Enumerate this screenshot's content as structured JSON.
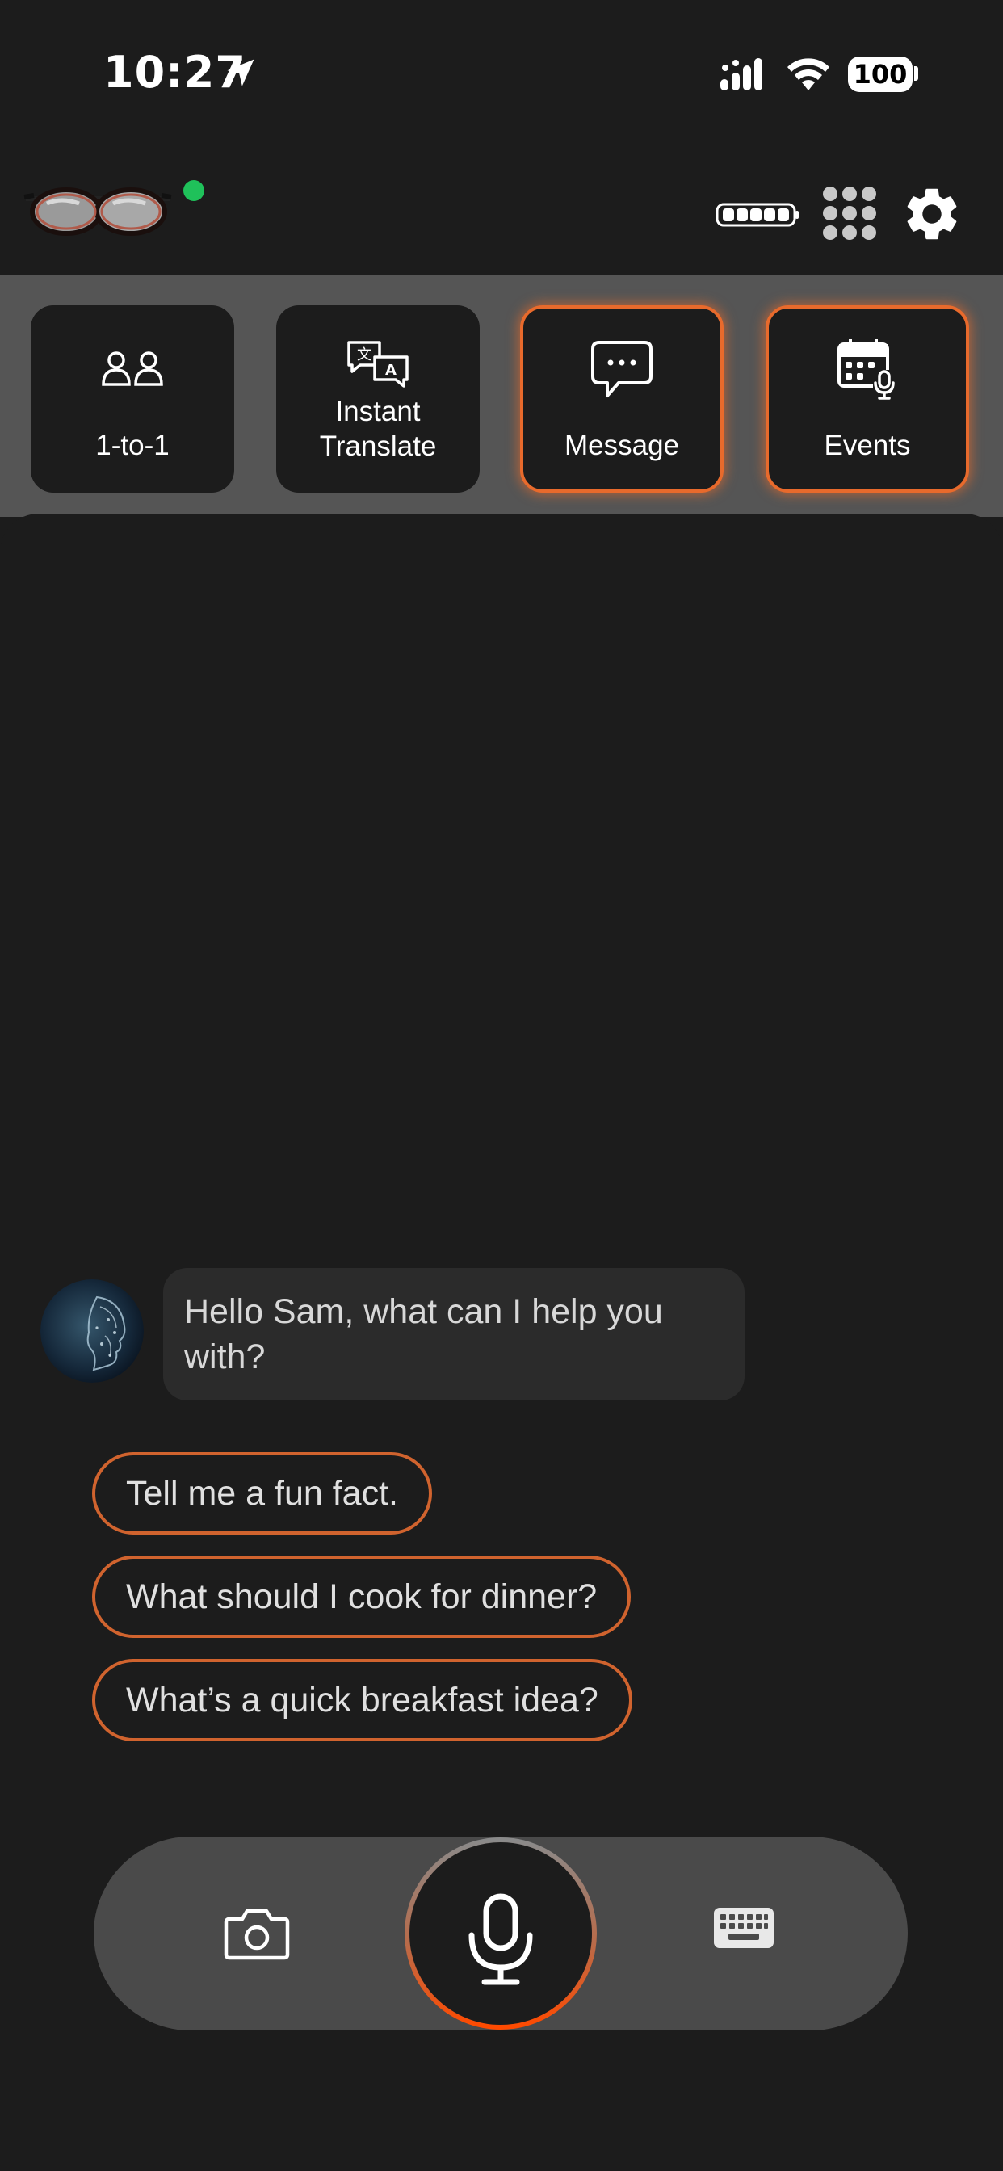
{
  "status_bar": {
    "time": "10:27",
    "battery": "100"
  },
  "modes": [
    {
      "label": "1-to-1",
      "icon": "people-icon",
      "active": false
    },
    {
      "label": "Instant\nTranslate",
      "icon": "translate-icon",
      "active": false
    },
    {
      "label": "Message",
      "icon": "chat-bubble-icon",
      "active": true
    },
    {
      "label": "Events",
      "icon": "calendar-mic-icon",
      "active": true
    }
  ],
  "chat": {
    "assistant_message": "Hello Sam, what can I help you with?"
  },
  "suggestions": [
    "Tell me a fun fact.",
    "What should I cook for dinner?",
    "What’s a quick breakfast idea?"
  ],
  "colors": {
    "accent": "#e86a2c",
    "connected": "#1fc15a",
    "background": "#1c1c1c",
    "strip": "#555555"
  }
}
